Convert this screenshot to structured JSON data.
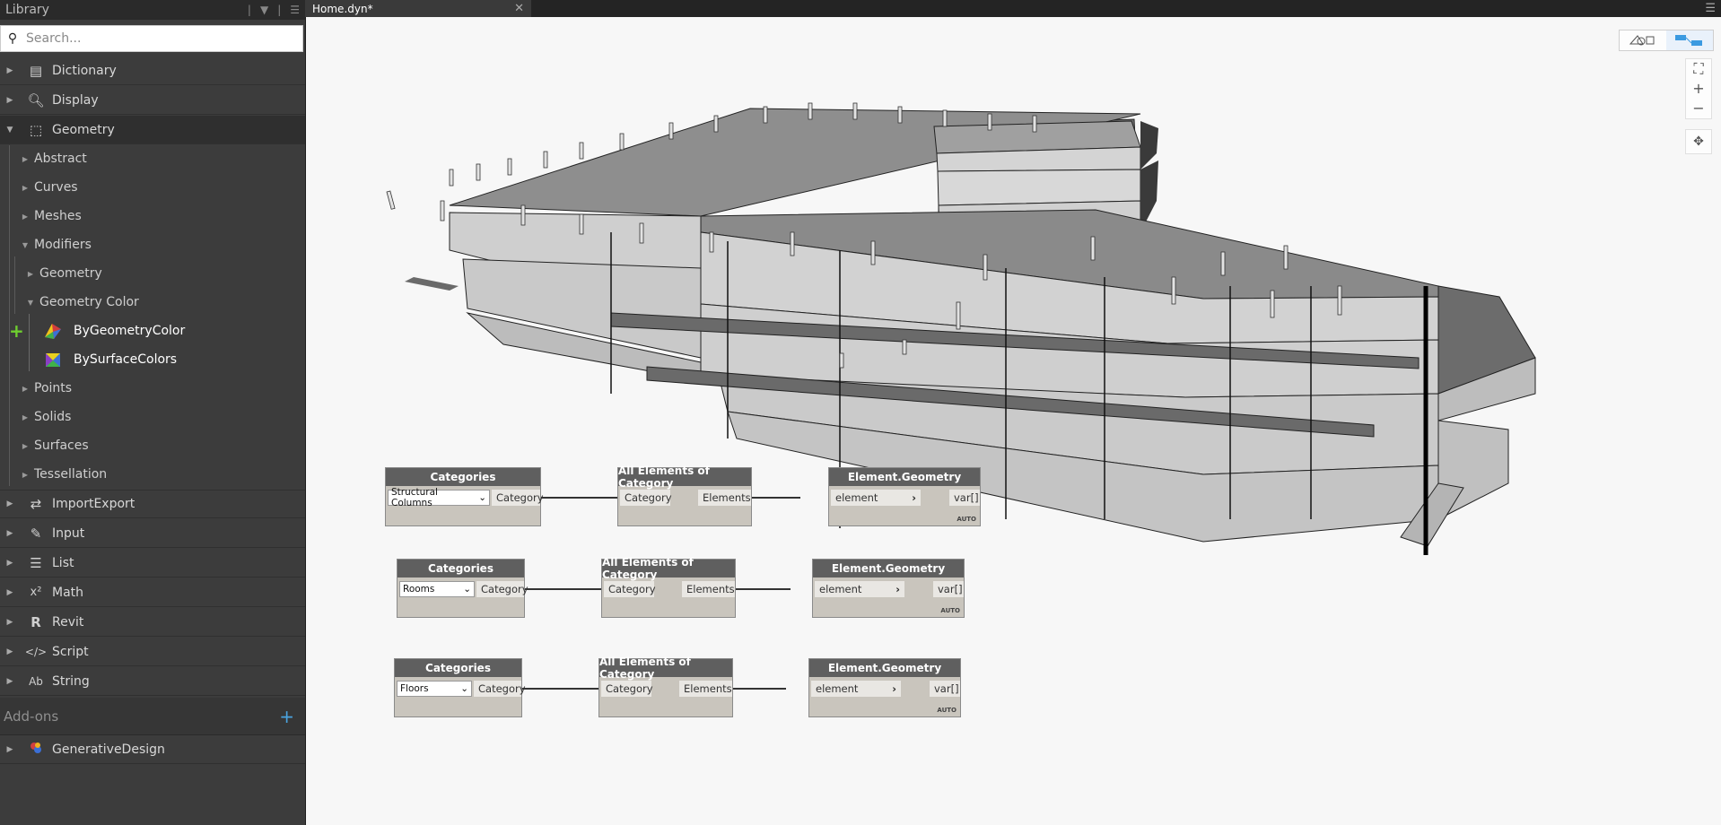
{
  "library": {
    "title": "Library",
    "search_placeholder": "Search...",
    "categories": [
      {
        "label": "Dictionary",
        "icon": "dictionary-icon"
      },
      {
        "label": "Display",
        "icon": "display-icon"
      },
      {
        "label": "Geometry",
        "icon": "geometry-icon"
      }
    ],
    "geometry_children": [
      "Abstract",
      "Curves",
      "Meshes",
      "Modifiers"
    ],
    "modifiers_children": [
      "Geometry",
      "Geometry Color"
    ],
    "geometry_color_leaves": [
      "ByGeometryColor",
      "BySurfaceColors"
    ],
    "geometry_children_after": [
      "Points",
      "Solids",
      "Surfaces",
      "Tessellation"
    ],
    "categories_after": [
      {
        "label": "ImportExport",
        "icon": "import-export-icon"
      },
      {
        "label": "Input",
        "icon": "pencil-icon"
      },
      {
        "label": "List",
        "icon": "list-icon"
      },
      {
        "label": "Math",
        "icon": "math-icon"
      },
      {
        "label": "Revit",
        "icon": "revit-icon"
      },
      {
        "label": "Script",
        "icon": "script-icon"
      },
      {
        "label": "String",
        "icon": "string-icon"
      }
    ],
    "addons_label": "Add-ons",
    "addons": [
      {
        "label": "GenerativeDesign",
        "icon": "generative-design-icon"
      }
    ]
  },
  "workspace": {
    "tab_title": "Home.dyn*"
  },
  "graph": {
    "rows": [
      {
        "categories": {
          "title": "Categories",
          "dropdown": "Structural Columns",
          "output": "Category"
        },
        "all_elements": {
          "title": "All Elements of Category",
          "input": "Category",
          "output": "Elements"
        },
        "geometry": {
          "title": "Element.Geometry",
          "input": "element",
          "output": "var[]",
          "lacing": "AUTO"
        }
      },
      {
        "categories": {
          "title": "Categories",
          "dropdown": "Rooms",
          "output": "Category"
        },
        "all_elements": {
          "title": "All Elements of Category",
          "input": "Category",
          "output": "Elements"
        },
        "geometry": {
          "title": "Element.Geometry",
          "input": "element",
          "output": "var[]",
          "lacing": "AUTO"
        }
      },
      {
        "categories": {
          "title": "Categories",
          "dropdown": "Floors",
          "output": "Category"
        },
        "all_elements": {
          "title": "All Elements of Category",
          "input": "Category",
          "output": "Elements"
        },
        "geometry": {
          "title": "Element.Geometry",
          "input": "element",
          "output": "var[]",
          "lacing": "AUTO"
        }
      }
    ]
  }
}
